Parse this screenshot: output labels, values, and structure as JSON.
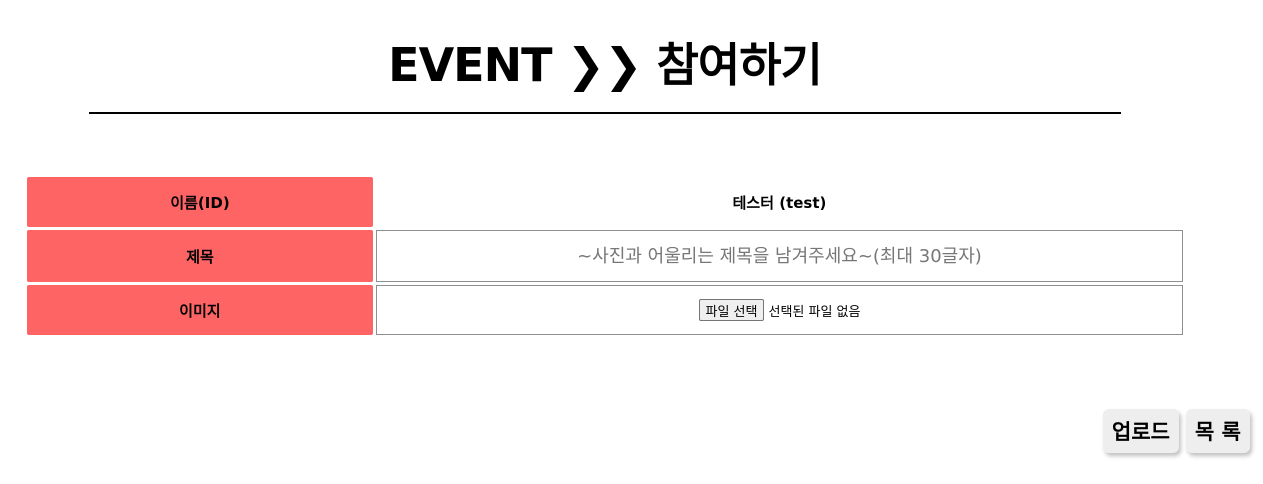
{
  "header": {
    "title": "EVENT ❯❯ 참여하기"
  },
  "form": {
    "name_row": {
      "label": "이름(ID)",
      "value": "테스터 (test)"
    },
    "subject_row": {
      "label": "제목",
      "value": "",
      "placeholder": "~사진과 어울리는 제목을 남겨주세요~(최대 30글자)"
    },
    "image_row": {
      "label": "이미지",
      "button_label": "파일 선택",
      "status": "선택된 파일 없음"
    }
  },
  "actions": {
    "upload_label": "업로드",
    "list_label": "목 록"
  }
}
